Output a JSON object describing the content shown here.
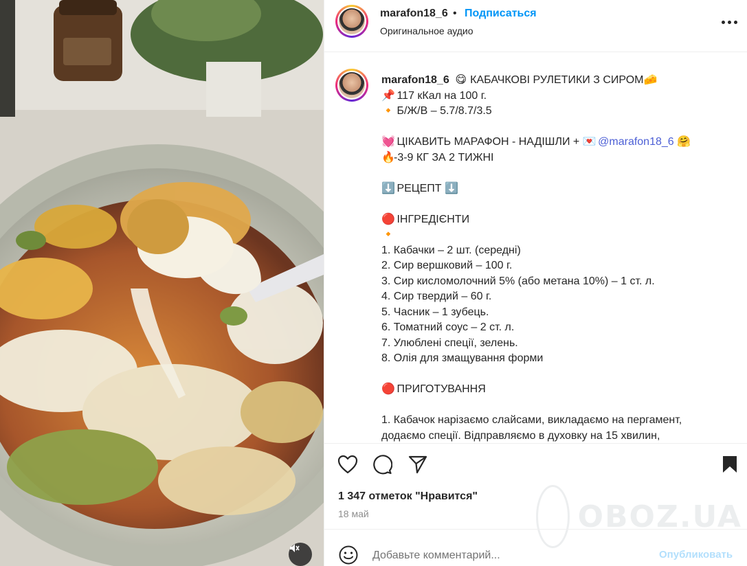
{
  "post": {
    "author": "marafon18_6",
    "follow_label": "Подписаться",
    "separator": "•",
    "audio_label": "Оригинальное аудио",
    "likes_text": "1 347 отметок \"Нравится\"",
    "date_text": "18 май"
  },
  "caption": {
    "title_emoji": "😋",
    "title": "КАБАЧКОВІ РУЛЕТИКИ З СИРОМ",
    "title_emoji_end": "🧀",
    "kcal_emoji": "📌",
    "kcal": "117 кКал на 100 г.",
    "bju_emoji": "🔸",
    "bju": "Б/Ж/В – 5.7/8.7/3.5",
    "marathon_emoji": "💓",
    "marathon_text": "ЦІКАВИТЬ МАРАФОН - НАДІШЛИ +",
    "marathon_emoji2": "💌",
    "mention": "@marafon18_6",
    "marathon_emoji3": "🤗",
    "loss_emoji": "🔥",
    "loss_text": "-3-9 КГ ЗА 2 ТИЖНІ",
    "recipe_arrow": "⬇️",
    "recipe_title": "РЕЦЕПТ",
    "ingredients_emoji": "🔴",
    "ingredients_title": "ІНГРЕДІЄНТИ",
    "diamond_emoji": "🔸",
    "ingredients": [
      "1. Кабачки – 2 шт. (середні)",
      "2. Сир вершковий – 100 г.",
      "3. Сир кисломолочний 5% (або метана 10%) – 1 ст. л.",
      "4. Сир твердий – 60 г.",
      "5. Часник – 1 зубець.",
      "6. Томатний соус – 2 ст. л.",
      "7. Улюблені спеції, зелень.",
      "8. Олія для змащування форми"
    ],
    "prep_emoji": "🔴",
    "prep_title": "ПРИГОТУВАННЯ",
    "steps": [
      "1. Кабачок нарізаємо слайсами, викладаємо на пергамент,",
      "додаємо спеції. Відправляємо в духовку на 15 хвилин,"
    ]
  },
  "comment": {
    "placeholder": "Добавьте комментарий...",
    "publish_label": "Опубликовать"
  },
  "watermark": "OBOZ.UA",
  "icons": {
    "like": "heart-icon",
    "comment": "comment-icon",
    "share": "send-icon",
    "save": "bookmark-icon",
    "more": "more-icon",
    "emoji": "smile-icon",
    "mute": "speaker-muted-icon"
  },
  "colors": {
    "accent": "#0095f6",
    "mention": "#4c5fd5",
    "text": "#262626",
    "muted": "#8e8e8e",
    "publish_disabled": "#b2dffc"
  }
}
